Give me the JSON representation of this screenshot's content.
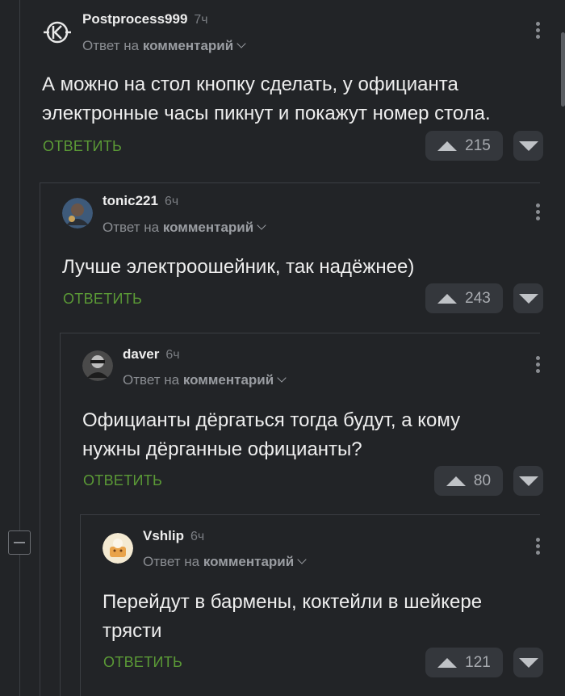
{
  "comments": [
    {
      "author": "Postprocess999",
      "time": "7ч",
      "reply_prefix": "Ответ на",
      "reply_target": "комментарий",
      "text": "А можно на стол кнопку сделать, у официанта электронные часы пикнут и покажут номер стола.",
      "reply_label": "ОТВЕТИТЬ",
      "rating": "215"
    },
    {
      "author": "tonic221",
      "time": "6ч",
      "reply_prefix": "Ответ на",
      "reply_target": "комментарий",
      "text": "Лучше электроошейник, так надёжнее)",
      "reply_label": "ОТВЕТИТЬ",
      "rating": "243"
    },
    {
      "author": "daver",
      "time": "6ч",
      "reply_prefix": "Ответ на",
      "reply_target": "комментарий",
      "text": "Официанты дёргаться тогда будут, а кому нужны дёрганные официанты?",
      "reply_label": "ОТВЕТИТЬ",
      "rating": "80"
    },
    {
      "author": "Vshlip",
      "time": "6ч",
      "reply_prefix": "Ответ на",
      "reply_target": "комментарий",
      "text": "Перейдут в бармены, коктейли в шейкере трясти",
      "reply_label": "ОТВЕТИТЬ",
      "rating": "121"
    }
  ],
  "icons": {
    "upvote": "triangle-up-icon",
    "downvote": "triangle-down-icon",
    "more": "kebab-menu-icon",
    "collapse": "minus-square-icon"
  },
  "colors": {
    "background": "#222427",
    "accent_reply": "#5b9a36",
    "vote_bg": "#34373c"
  }
}
